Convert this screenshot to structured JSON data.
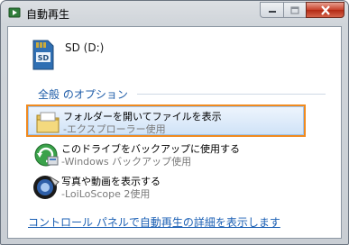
{
  "window": {
    "title": "自動再生",
    "icon": "autoplay-icon",
    "controls": [
      "minimize-icon",
      "maximize-icon",
      "close-icon"
    ]
  },
  "device": {
    "icon": "sd-card-icon",
    "label": "SD (D:)"
  },
  "section": {
    "label": "全般 のオプション"
  },
  "options": [
    {
      "main": "フォルダーを開いてファイルを表示",
      "sub": "-エクスプローラー使用",
      "icon": "folder-icon",
      "selected": true
    },
    {
      "main": "このドライブをバックアップに使用する",
      "sub": "-Windows バックアップ使用",
      "icon": "backup-icon",
      "selected": false
    },
    {
      "main": "写真や動画を表示する",
      "sub": "-LoiLoScope 2使用",
      "icon": "loiloscope-icon",
      "selected": false
    }
  ],
  "footer": {
    "link": "コントロール パネルで自動再生の詳細を表示します"
  },
  "colors": {
    "section_text": "#1e5ca8",
    "link": "#1a5fb4",
    "selection_border": "#f08a1f"
  }
}
